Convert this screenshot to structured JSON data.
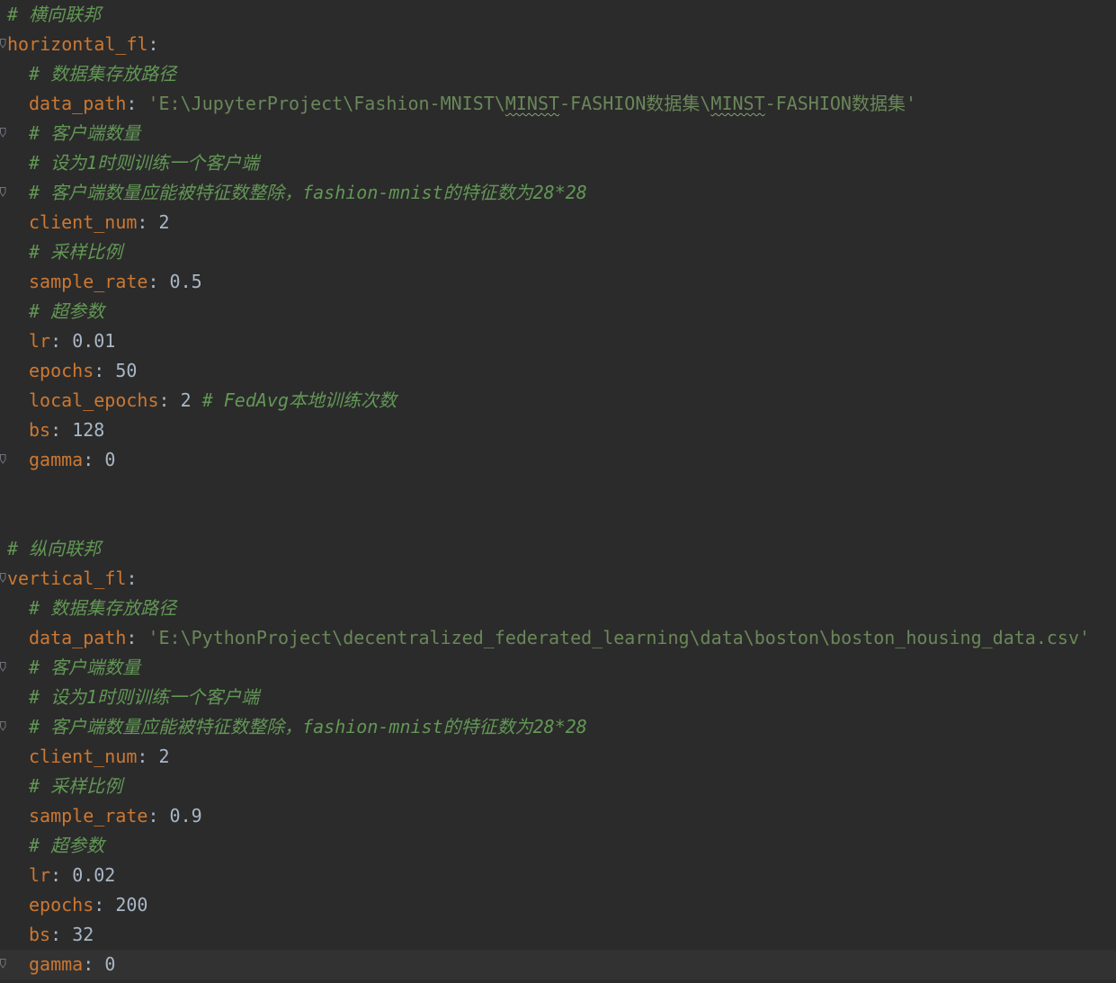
{
  "editor": {
    "language": "yaml",
    "colors": {
      "background": "#2b2b2b",
      "current_line": "#323232",
      "key": "#cc7832",
      "string": "#6a8759",
      "comment": "#629755",
      "text": "#a9b7c6"
    },
    "current_line_index": 32,
    "lines": [
      {
        "indent": 0,
        "fold": false,
        "parts": [
          {
            "t": "comment",
            "v": "# 横向联邦"
          }
        ]
      },
      {
        "indent": 0,
        "fold": true,
        "parts": [
          {
            "t": "key",
            "v": "horizontal_fl"
          },
          {
            "t": "punct",
            "v": ":"
          }
        ]
      },
      {
        "indent": 1,
        "fold": false,
        "parts": [
          {
            "t": "comment",
            "v": "# 数据集存放路径"
          }
        ]
      },
      {
        "indent": 1,
        "fold": false,
        "parts": [
          {
            "t": "key",
            "v": "data_path"
          },
          {
            "t": "punct",
            "v": ": "
          },
          {
            "t": "str",
            "v": "'E:\\JupyterProject\\Fashion-MNIST\\"
          },
          {
            "t": "str-typo",
            "v": "MINST"
          },
          {
            "t": "str",
            "v": "-FASHION数据集\\"
          },
          {
            "t": "str-typo",
            "v": "MINST"
          },
          {
            "t": "str",
            "v": "-FASHION数据集'"
          }
        ]
      },
      {
        "indent": 1,
        "fold": true,
        "parts": [
          {
            "t": "comment",
            "v": "# 客户端数量"
          }
        ]
      },
      {
        "indent": 1,
        "fold": false,
        "parts": [
          {
            "t": "comment",
            "v": "# 设为1时则训练一个客户端"
          }
        ]
      },
      {
        "indent": 1,
        "fold": true,
        "parts": [
          {
            "t": "comment",
            "v": "# 客户端数量应能被特征数整除，fashion-mnist的特征数为28*28"
          }
        ]
      },
      {
        "indent": 1,
        "fold": false,
        "parts": [
          {
            "t": "key",
            "v": "client_num"
          },
          {
            "t": "punct",
            "v": ": "
          },
          {
            "t": "num",
            "v": "2"
          }
        ]
      },
      {
        "indent": 1,
        "fold": false,
        "parts": [
          {
            "t": "comment",
            "v": "# 采样比例"
          }
        ]
      },
      {
        "indent": 1,
        "fold": false,
        "parts": [
          {
            "t": "key",
            "v": "sample_rate"
          },
          {
            "t": "punct",
            "v": ": "
          },
          {
            "t": "num",
            "v": "0.5"
          }
        ]
      },
      {
        "indent": 1,
        "fold": false,
        "parts": [
          {
            "t": "comment",
            "v": "# 超参数"
          }
        ]
      },
      {
        "indent": 1,
        "fold": false,
        "parts": [
          {
            "t": "key",
            "v": "lr"
          },
          {
            "t": "punct",
            "v": ": "
          },
          {
            "t": "num",
            "v": "0.01"
          }
        ]
      },
      {
        "indent": 1,
        "fold": false,
        "parts": [
          {
            "t": "key",
            "v": "epochs"
          },
          {
            "t": "punct",
            "v": ": "
          },
          {
            "t": "num",
            "v": "50"
          }
        ]
      },
      {
        "indent": 1,
        "fold": false,
        "parts": [
          {
            "t": "key",
            "v": "local_epochs"
          },
          {
            "t": "punct",
            "v": ": "
          },
          {
            "t": "num",
            "v": "2 "
          },
          {
            "t": "comment",
            "v": "# FedAvg本地训练次数"
          }
        ]
      },
      {
        "indent": 1,
        "fold": false,
        "parts": [
          {
            "t": "key",
            "v": "bs"
          },
          {
            "t": "punct",
            "v": ": "
          },
          {
            "t": "num",
            "v": "128"
          }
        ]
      },
      {
        "indent": 1,
        "fold": true,
        "parts": [
          {
            "t": "key",
            "v": "gamma"
          },
          {
            "t": "punct",
            "v": ": "
          },
          {
            "t": "num",
            "v": "0"
          }
        ]
      },
      {
        "indent": 0,
        "fold": false,
        "parts": []
      },
      {
        "indent": 0,
        "fold": false,
        "parts": []
      },
      {
        "indent": 0,
        "fold": false,
        "parts": [
          {
            "t": "comment",
            "v": "# 纵向联邦"
          }
        ]
      },
      {
        "indent": 0,
        "fold": true,
        "parts": [
          {
            "t": "key",
            "v": "vertical_fl"
          },
          {
            "t": "punct",
            "v": ":"
          }
        ]
      },
      {
        "indent": 1,
        "fold": false,
        "parts": [
          {
            "t": "comment",
            "v": "# 数据集存放路径"
          }
        ]
      },
      {
        "indent": 1,
        "fold": false,
        "parts": [
          {
            "t": "key",
            "v": "data_path"
          },
          {
            "t": "punct",
            "v": ": "
          },
          {
            "t": "str",
            "v": "'E:\\PythonProject\\decentralized_federated_learning\\data\\boston\\boston_housing_data.csv'"
          }
        ]
      },
      {
        "indent": 1,
        "fold": true,
        "parts": [
          {
            "t": "comment",
            "v": "# 客户端数量"
          }
        ]
      },
      {
        "indent": 1,
        "fold": false,
        "parts": [
          {
            "t": "comment",
            "v": "# 设为1时则训练一个客户端"
          }
        ]
      },
      {
        "indent": 1,
        "fold": true,
        "parts": [
          {
            "t": "comment",
            "v": "# 客户端数量应能被特征数整除，fashion-mnist的特征数为28*28"
          }
        ]
      },
      {
        "indent": 1,
        "fold": false,
        "parts": [
          {
            "t": "key",
            "v": "client_num"
          },
          {
            "t": "punct",
            "v": ": "
          },
          {
            "t": "num",
            "v": "2"
          }
        ]
      },
      {
        "indent": 1,
        "fold": false,
        "parts": [
          {
            "t": "comment",
            "v": "# 采样比例"
          }
        ]
      },
      {
        "indent": 1,
        "fold": false,
        "parts": [
          {
            "t": "key",
            "v": "sample_rate"
          },
          {
            "t": "punct",
            "v": ": "
          },
          {
            "t": "num",
            "v": "0.9"
          }
        ]
      },
      {
        "indent": 1,
        "fold": false,
        "parts": [
          {
            "t": "comment",
            "v": "# 超参数"
          }
        ]
      },
      {
        "indent": 1,
        "fold": false,
        "parts": [
          {
            "t": "key",
            "v": "lr"
          },
          {
            "t": "punct",
            "v": ": "
          },
          {
            "t": "num",
            "v": "0.02"
          }
        ]
      },
      {
        "indent": 1,
        "fold": false,
        "parts": [
          {
            "t": "key",
            "v": "epochs"
          },
          {
            "t": "punct",
            "v": ": "
          },
          {
            "t": "num",
            "v": "200"
          }
        ]
      },
      {
        "indent": 1,
        "fold": false,
        "parts": [
          {
            "t": "key",
            "v": "bs"
          },
          {
            "t": "punct",
            "v": ": "
          },
          {
            "t": "num",
            "v": "32"
          }
        ]
      },
      {
        "indent": 1,
        "fold": true,
        "parts": [
          {
            "t": "key",
            "v": "gamma"
          },
          {
            "t": "punct",
            "v": ": "
          },
          {
            "t": "num",
            "v": "0"
          }
        ]
      }
    ]
  }
}
